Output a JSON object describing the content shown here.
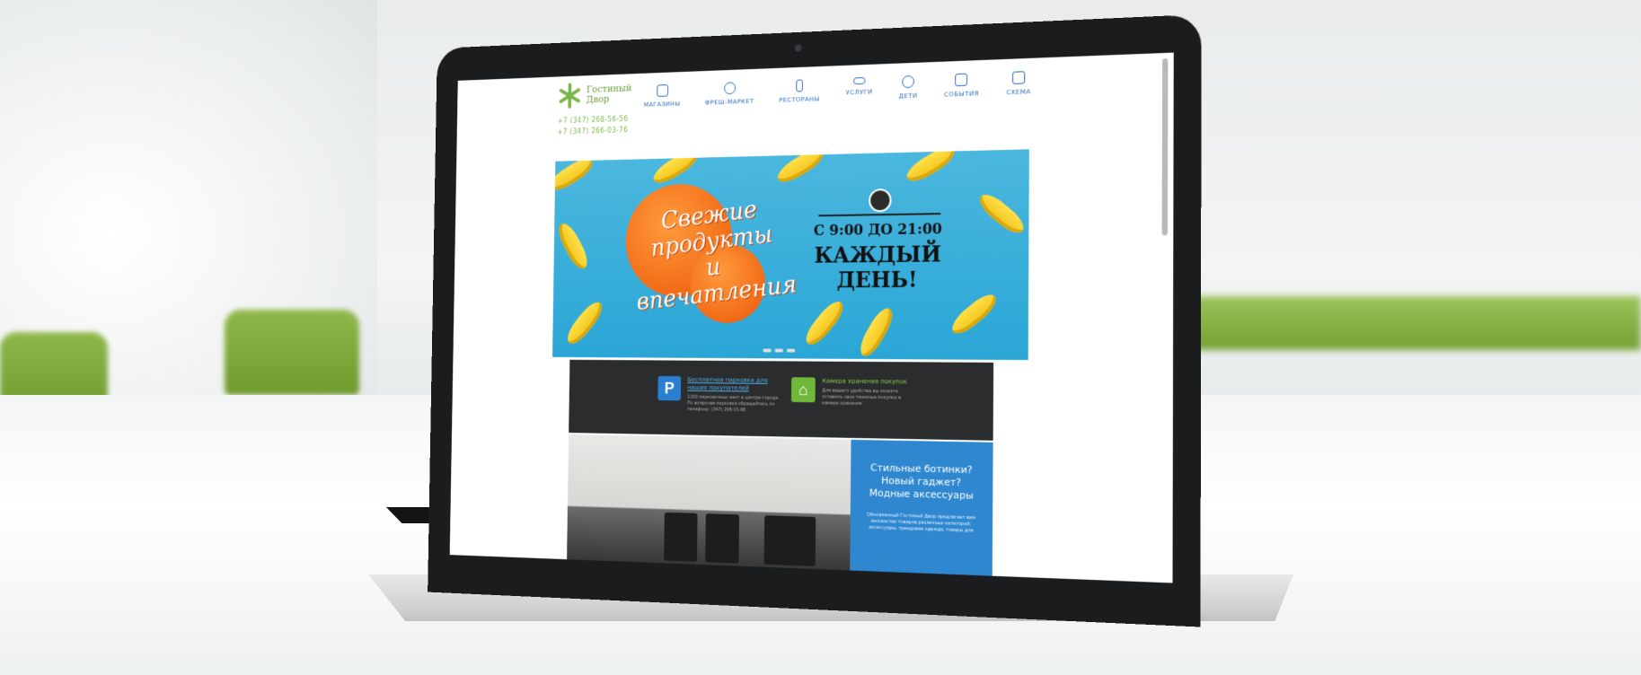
{
  "logo": {
    "text": "Гостиный Двор"
  },
  "phones": [
    "+7 (347) 268-56-56",
    "+7 (347) 266-03-76"
  ],
  "nav": [
    {
      "label": "МАГАЗИНЫ",
      "icon": "bag-icon"
    },
    {
      "label": "ФРЕШ-МАРКЕТ",
      "icon": "apple-icon"
    },
    {
      "label": "РЕСТОРАНЫ",
      "icon": "fork-knife-icon"
    },
    {
      "label": "УСЛУГИ",
      "icon": "glasses-icon"
    },
    {
      "label": "ДЕТИ",
      "icon": "balloon-icon"
    },
    {
      "label": "СОБЫТИЯ",
      "icon": "calendar-icon"
    },
    {
      "label": "СХЕМА",
      "icon": "map-icon"
    }
  ],
  "banner": {
    "slogan_line1": "Свежие",
    "slogan_line2": "продукты",
    "slogan_line3": "и впечатления",
    "hours": "С 9:00 ДО 21:00",
    "everyday_line1": "КАЖДЫЙ",
    "everyday_line2": "ДЕНЬ!"
  },
  "services": {
    "parking": {
      "icon_letter": "P",
      "title": "Бесплатная парковка для наших покупателей",
      "desc": "1200 парковочных мест в центре города. По вопросам парковки обращайтесь по телефону: (347) 298-15-98"
    },
    "storage": {
      "title": "Камера хранения покупок",
      "desc": "Для вашего удобства вы можете оставить свои тяжелые покупки в камере хранения"
    }
  },
  "promo": {
    "head_line1": "Стильные ботинки?",
    "head_line2": "Новый гаджет?",
    "head_line3": "Модные аксессуары",
    "text": "Обновленный Гостиный Двор предлагает вам множество товаров различных категорий: аксессуары, трендовая одежда, товары для"
  },
  "colors": {
    "brand_green": "#7ab648",
    "nav_blue": "#2a6bbd",
    "banner_blue": "#2aa6d6",
    "promo_blue": "#2e87cf"
  }
}
